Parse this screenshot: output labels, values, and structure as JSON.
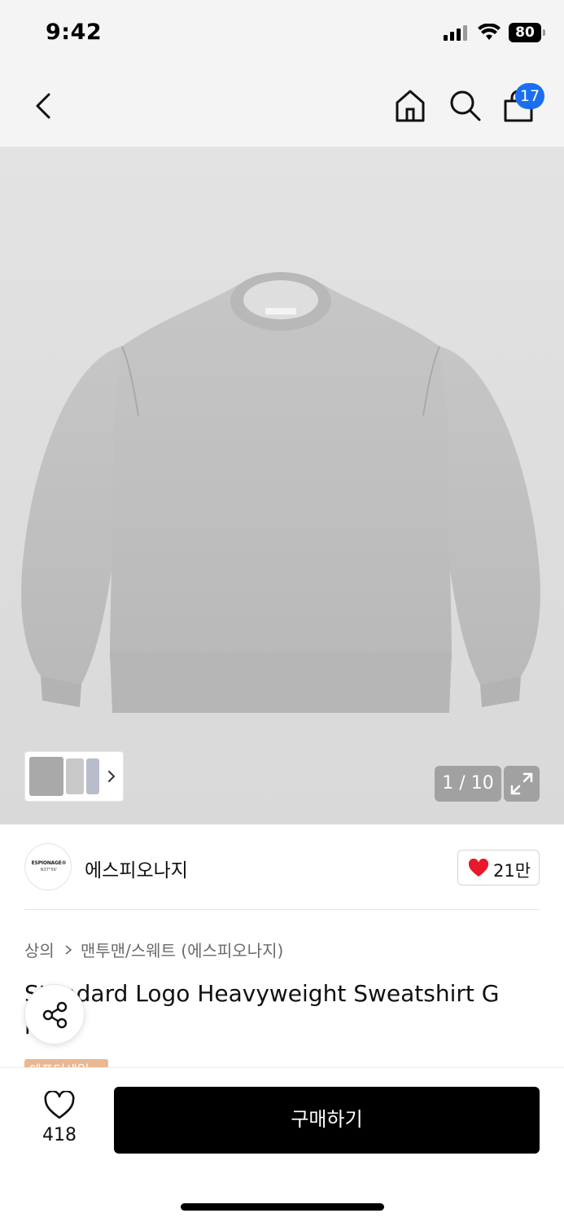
{
  "status_bar": {
    "time": "9:42",
    "battery": "80",
    "icons": [
      "signal-icon",
      "wifi-icon",
      "battery-icon"
    ]
  },
  "nav": {
    "back_icon": "chevron-left-icon",
    "home_icon": "home-icon",
    "search_icon": "search-icon",
    "bag_icon": "shopping-bag-icon",
    "cart_count": "17"
  },
  "gallery": {
    "page_counter": "1 / 10",
    "expand_icon": "expand-icon",
    "thumbnail_arrow_icon": "chevron-right-icon"
  },
  "brand": {
    "logo_text": "ESPIONAGE®",
    "logo_subtext": "N37°56'",
    "name": "에스피오나지",
    "likes": "21만"
  },
  "product": {
    "breadcrumb": [
      "상의",
      "맨투맨/스웨트 (에스피오나지)"
    ],
    "title_line1": "Standard Logo Heavyweight Sweatshirt G",
    "title_line2_visible": "r",
    "sale_tag": "에프터세일"
  },
  "bottom_bar": {
    "wish_count": "418",
    "buy_label": "구매하기"
  },
  "colors": {
    "accent_badge": "#1a6ff0",
    "heart": "#e8192c",
    "sale_tag": "#e8b893",
    "buy_button": "#000000"
  }
}
